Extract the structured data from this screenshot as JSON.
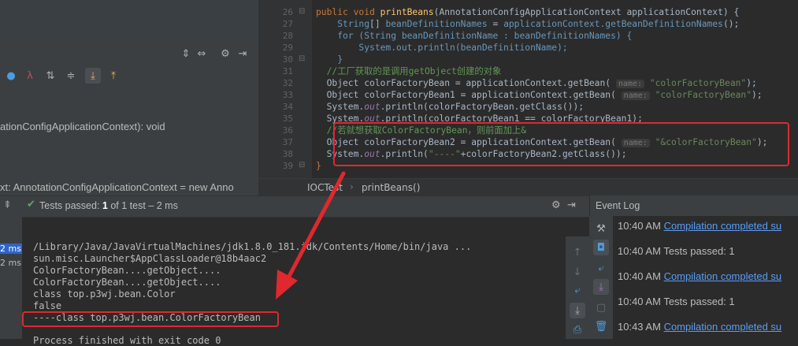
{
  "left_panel": {
    "method_signature": "ationConfigApplicationContext): void",
    "variable_line": "xt: AnnotationConfigApplicationContext = new Anno"
  },
  "editor": {
    "line_numbers": [
      "26",
      "27",
      "28",
      "29",
      "30",
      "31",
      "32",
      "33",
      "34",
      "35",
      "36",
      "37",
      "38",
      "39"
    ],
    "breadcrumb": [
      "IOCTest",
      "printBeans()"
    ]
  },
  "run": {
    "time_a": "2 ms",
    "time_b": "2 ms",
    "status_prefix": "Tests passed:",
    "status_count": "1",
    "status_suffix": "of 1 test – 2 ms",
    "console_lines": [
      "/Library/Java/JavaVirtualMachines/jdk1.8.0_181.jdk/Contents/Home/bin/java ...",
      "sun.misc.Launcher$AppClassLoader@18b4aac2",
      "ColorFactoryBean....getObject....",
      "ColorFactoryBean....getObject....",
      "class top.p3wj.bean.Color",
      "false",
      "----class top.p3wj.bean.ColorFactoryBean",
      "Process finished with exit code 0"
    ]
  },
  "event_log": {
    "title": "Event Log",
    "entries": [
      {
        "time": "10:40 AM",
        "text": "Compilation completed su",
        "link": true
      },
      {
        "time": "10:40 AM",
        "text": "Tests passed: 1",
        "link": false
      },
      {
        "time": "10:40 AM",
        "text": "Compilation completed su",
        "link": true
      },
      {
        "time": "10:40 AM",
        "text": "Tests passed: 1",
        "link": false
      },
      {
        "time": "10:43 AM",
        "text": "Compilation completed su",
        "link": true
      }
    ]
  },
  "colors": {
    "accent_red": "#e0282e",
    "link": "#589df6",
    "pass_green": "#59a869"
  }
}
